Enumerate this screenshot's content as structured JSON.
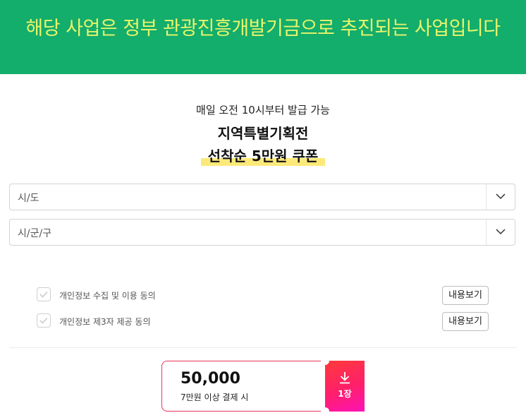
{
  "banner": {
    "text": "해당 사업은 정부 관광진흥개발기금으로 추진되는 사업입니다"
  },
  "promo": {
    "subtitle": "매일 오전 10시부터 발급 가능",
    "title_line1": "지역특별기획전",
    "title_line2": "선착순 5만원 쿠폰"
  },
  "selects": {
    "region": {
      "placeholder": "시/도"
    },
    "district": {
      "placeholder": "시/군/구"
    }
  },
  "agreements": [
    {
      "label": "개인정보 수집 및 이용 동의",
      "button": "내용보기"
    },
    {
      "label": "개인정보 제3자 제공 동의",
      "button": "내용보기"
    }
  ],
  "coupon": {
    "amount": "50,000",
    "condition": "7만원 이상 결제 시",
    "count": "1장"
  },
  "colors": {
    "banner_bg": "#13ad6c",
    "banner_text": "#e9f56b",
    "highlight": "#fce97a",
    "coupon_accent": "#ff1f6b"
  }
}
